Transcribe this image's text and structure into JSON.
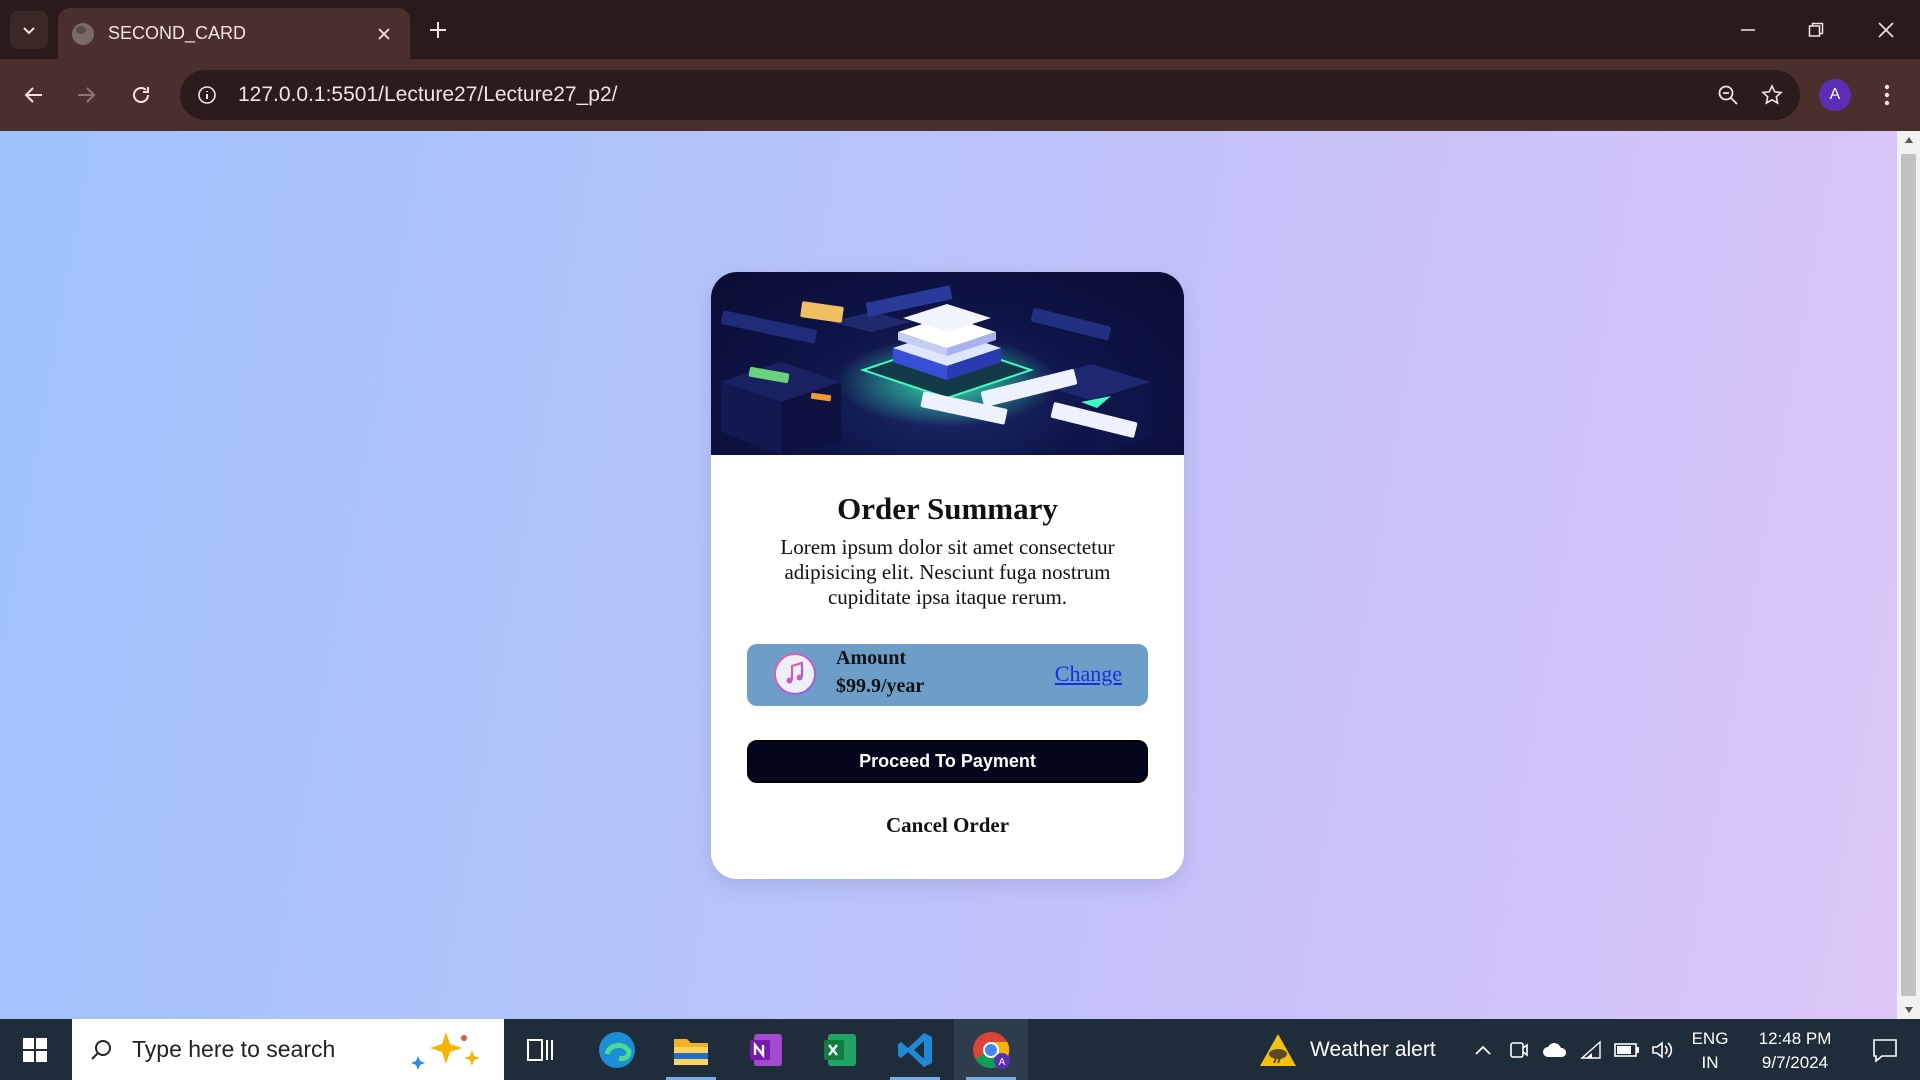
{
  "browser": {
    "tab_title": "SECOND_CARD",
    "url": "127.0.0.1:5501/Lecture27/Lecture27_p2/",
    "profile_initial": "A"
  },
  "card": {
    "title": "Order Summary",
    "description": "Lorem ipsum dolor sit amet consectetur adipisicing elit. Nesciunt fuga nostrum cupiditate ipsa itaque rerum.",
    "amount_label": "Amount",
    "amount_value": "$99.9/year",
    "change_link": "Change",
    "proceed_label": "Proceed To Payment",
    "cancel_label": "Cancel Order",
    "icon": "music-icon"
  },
  "taskbar": {
    "search_placeholder": "Type here to search",
    "weather_text": "Weather alert",
    "language_line1": "ENG",
    "language_line2": "IN",
    "time": "12:48 PM",
    "date": "9/7/2024",
    "apps": [
      "task-view-icon",
      "edge-icon",
      "file-explorer-icon",
      "onenote-icon",
      "excel-icon",
      "vscode-icon",
      "chrome-icon"
    ]
  },
  "colors": {
    "accent_dark": "#04061c",
    "amount_bg": "#6c9ec8",
    "link": "#1a2ee0"
  }
}
